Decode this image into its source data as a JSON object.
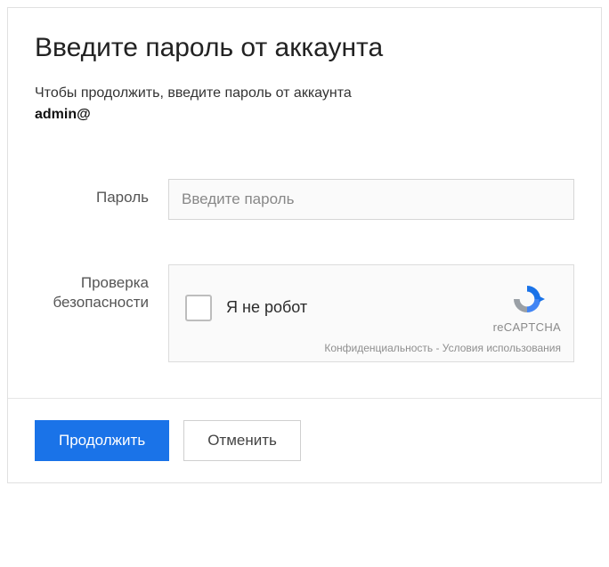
{
  "header": {
    "title": "Введите пароль от аккаунта"
  },
  "intro": {
    "text": "Чтобы продолжить, введите пароль от аккаунта",
    "account": "admin@"
  },
  "form": {
    "password": {
      "label": "Пароль",
      "placeholder": "Введите пароль",
      "value": ""
    },
    "security": {
      "label": "Проверка безопасности"
    }
  },
  "recaptcha": {
    "checkbox_label": "Я не робот",
    "brand": "reCAPTCHA",
    "privacy": "Конфиденциальность",
    "separator": " - ",
    "terms": "Условия использования"
  },
  "actions": {
    "continue": "Продолжить",
    "cancel": "Отменить"
  }
}
